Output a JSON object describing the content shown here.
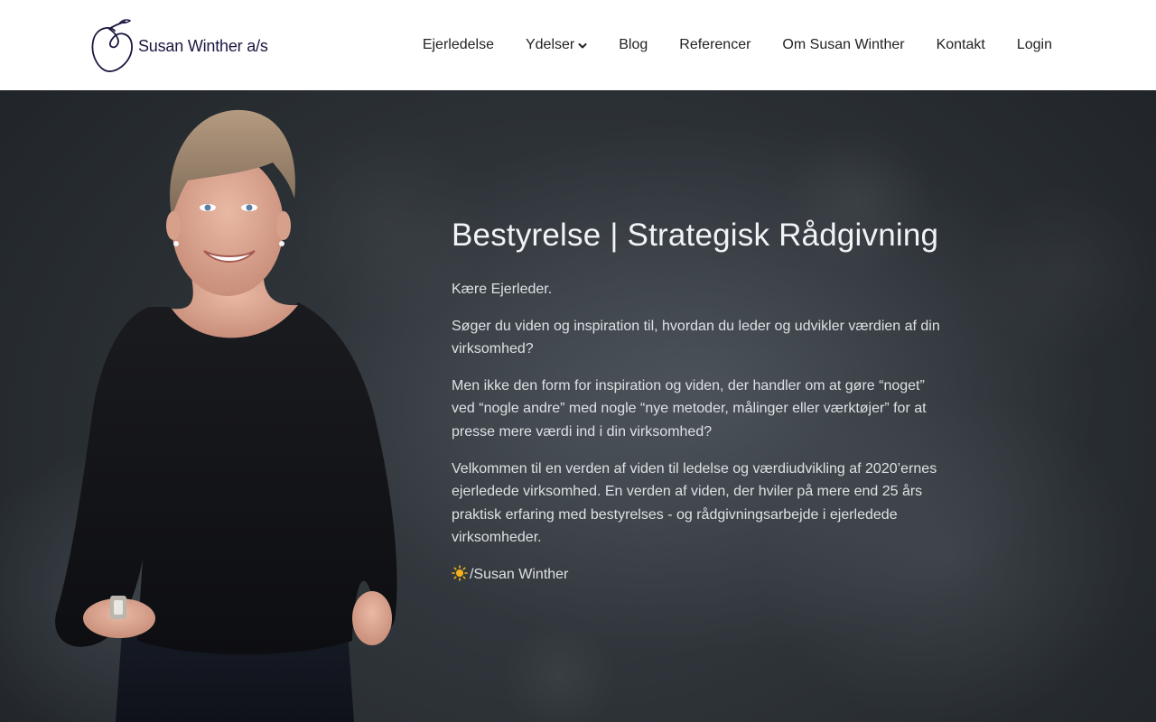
{
  "header": {
    "logo_text": "Susan Winther a/s",
    "nav": [
      {
        "label": "Ejerledelse"
      },
      {
        "label": "Ydelser",
        "has_dropdown": true
      },
      {
        "label": "Blog"
      },
      {
        "label": "Referencer"
      },
      {
        "label": "Om Susan Winther"
      },
      {
        "label": "Kontakt"
      },
      {
        "label": "Login"
      }
    ]
  },
  "hero": {
    "title": "Bestyrelse | Strategisk Rådgivning",
    "paragraphs": [
      "Kære Ejerleder.",
      "Søger du viden og inspiration til, hvordan du leder og udvikler værdien af din virksomhed?",
      "Men ikke den form for inspiration og viden, der handler om at gøre “noget” ved “nogle andre” med nogle “nye metoder, målinger eller værktøjer” for at presse mere værdi ind i din virksomhed?",
      "Velkommen til en verden af viden til ledelse og værdiudvikling af 2020’ernes ejerledede virksomhed. En verden af viden, der hviler på mere end 25 års praktisk erfaring med bestyrelses - og rådgivningsarbejde i ejerledede virksomheder."
    ],
    "signature": "/Susan Winther",
    "signature_icon": "sun-icon"
  },
  "colors": {
    "brand_navy": "#1a1740",
    "hero_bg": "#2a2f34",
    "hero_text": "#e9ecef"
  }
}
